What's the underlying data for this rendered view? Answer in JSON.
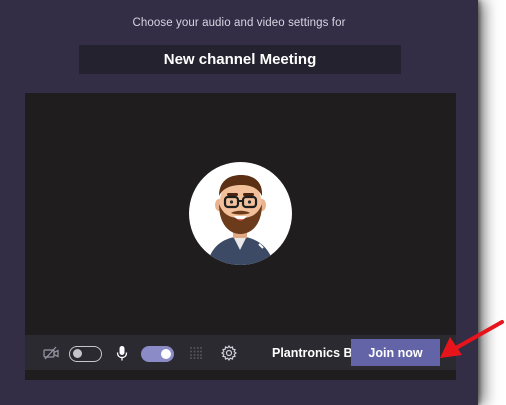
{
  "dialog": {
    "subtitle": "Choose your audio and video settings for",
    "meeting_title": "New channel Meeting"
  },
  "controls": {
    "camera": {
      "icon": "camera-off-icon",
      "enabled": false
    },
    "microphone": {
      "icon": "microphone-icon",
      "enabled": true
    },
    "background_effects": {
      "icon": "background-blur-icon"
    },
    "device_settings": {
      "icon": "gear-icon",
      "device_label": "Plantronics Bla..."
    },
    "join_button_label": "Join now"
  },
  "colors": {
    "window_bg": "#332d46",
    "title_bg": "#25222f",
    "preview_bg": "#1f1d1e",
    "controls_bg": "#2b2a31",
    "accent": "#6264a7",
    "toggle_on": "#8b8cc7",
    "annotation_arrow": "#e8141b"
  },
  "annotation": {
    "icon": "red-arrow-icon",
    "points_to": "join-now-button"
  }
}
